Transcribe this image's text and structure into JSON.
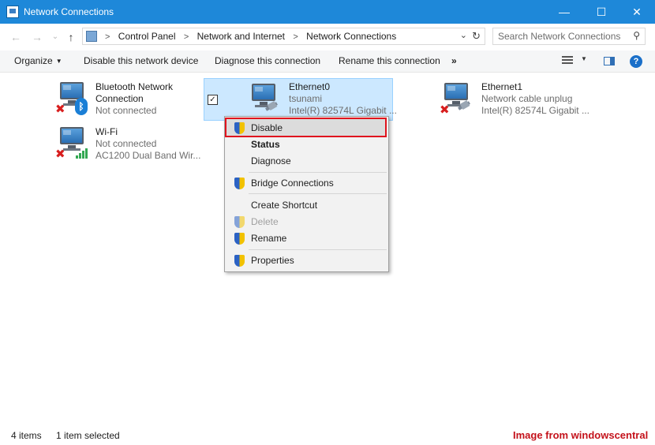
{
  "window": {
    "title": "Network Connections",
    "minimize": "—",
    "maximize": "☐",
    "close": "✕"
  },
  "nav": {
    "back": "←",
    "forward": "→",
    "recent": "⌄",
    "up": "↑"
  },
  "address": {
    "crumbs": [
      "Control Panel",
      "Network and Internet",
      "Network Connections"
    ],
    "separator": ">",
    "dropdown": "⌄",
    "refresh": "↻"
  },
  "search": {
    "placeholder": "Search Network Connections",
    "icon": "search-icon"
  },
  "toolbar": {
    "organize": "Organize",
    "disable": "Disable this network device",
    "diagnose": "Diagnose this connection",
    "rename": "Rename this connection",
    "more": "»",
    "help": "?"
  },
  "connections": [
    {
      "name": "Bluetooth Network Connection",
      "name_line1": "Bluetooth Network",
      "name_line2": "Connection",
      "status": "Not connected",
      "device": "",
      "badge": "bluetooth",
      "disconnected": true
    },
    {
      "name": "Ethernet0",
      "status": "tsunami",
      "device": "Intel(R) 82574L Gigabit ...",
      "badge": "cable",
      "disconnected": false,
      "selected": true
    },
    {
      "name": "Ethernet1",
      "status": "Network cable unplug",
      "device": "Intel(R) 82574L Gigabit ...",
      "badge": "cable",
      "disconnected": true
    },
    {
      "name": "Wi-Fi",
      "status": "Not connected",
      "device": "AC1200  Dual Band Wir...",
      "badge": "wifi",
      "disconnected": true
    }
  ],
  "context_menu": {
    "items": [
      {
        "label": "Disable",
        "shield": true,
        "bold": false,
        "disabled": false,
        "highlighted": true
      },
      {
        "label": "Status",
        "shield": false,
        "bold": true,
        "disabled": false
      },
      {
        "label": "Diagnose",
        "shield": false,
        "bold": false,
        "disabled": false
      },
      {
        "label": "Bridge Connections",
        "shield": true,
        "bold": false,
        "disabled": false
      },
      {
        "label": "Create Shortcut",
        "shield": false,
        "bold": false,
        "disabled": false
      },
      {
        "label": "Delete",
        "shield": true,
        "bold": false,
        "disabled": true
      },
      {
        "label": "Rename",
        "shield": true,
        "bold": false,
        "disabled": false
      },
      {
        "label": "Properties",
        "shield": true,
        "bold": false,
        "disabled": false
      }
    ]
  },
  "status": {
    "item_count": "4 items",
    "selection": "1 item selected"
  },
  "watermark": "Image from windowscentral",
  "colors": {
    "titlebar": "#1e88d9",
    "selection": "#cce8ff",
    "highlight_box": "#e0141e",
    "error_x": "#d81e1e"
  }
}
